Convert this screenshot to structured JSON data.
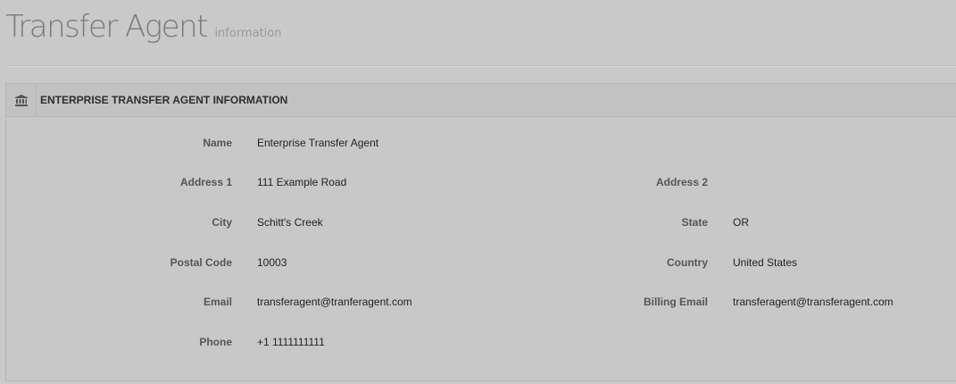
{
  "page": {
    "title": "Transfer Agent",
    "subtitle": "information"
  },
  "panel": {
    "icon": "bank-icon",
    "title": "ENTERPRISE TRANSFER AGENT INFORMATION"
  },
  "fields": {
    "name": {
      "label": "Name",
      "value": "Enterprise Transfer Agent"
    },
    "address1": {
      "label": "Address 1",
      "value": "111 Example Road"
    },
    "address2": {
      "label": "Address 2",
      "value": ""
    },
    "city": {
      "label": "City",
      "value": "Schitt's Creek"
    },
    "state": {
      "label": "State",
      "value": "OR"
    },
    "postal_code": {
      "label": "Postal Code",
      "value": "10003"
    },
    "country": {
      "label": "Country",
      "value": "United States"
    },
    "email": {
      "label": "Email",
      "value": "transferagent@tranferagent.com"
    },
    "billing_email": {
      "label": "Billing Email",
      "value": "transferagent@transferagent.com"
    },
    "phone": {
      "label": "Phone",
      "value": "+1 1111111111"
    }
  },
  "colors": {
    "background": "#c9c9c9",
    "panel_heading": "#c2c2c2",
    "label_text": "#555555",
    "value_text": "#222222"
  }
}
